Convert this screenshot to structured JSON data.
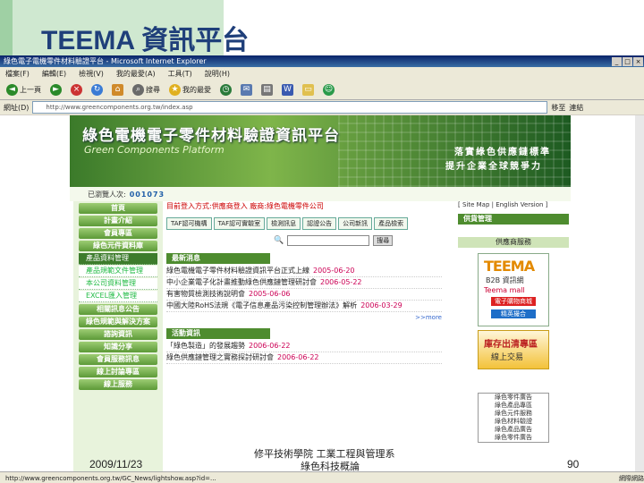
{
  "slide": {
    "title": "TEEMA 資訊平台",
    "footer_date": "2009/11/23",
    "footer_center_line1": "修平技術學院 工業工程與管理系",
    "footer_center_line2": "綠色科技概論",
    "footer_page": "90"
  },
  "browser": {
    "title": "綠色電子電機零件材料驗證平台 - Microsoft Internet Explorer",
    "menu": [
      "檔案(F)",
      "編輯(E)",
      "檢視(V)",
      "我的最愛(A)",
      "工具(T)",
      "說明(H)"
    ],
    "toolbar": {
      "back": "上一頁",
      "search": "搜尋",
      "favorites": "我的最愛"
    },
    "address_label": "網址(D)",
    "address_value": "http://www.greencomponents.org.tw/index.asp",
    "go_label": "移至",
    "links_label": "連結",
    "status_text": "http://www.greencomponents.org.tw/GC_News/lightshow.asp?id=...",
    "status_zone": "網際網路"
  },
  "site": {
    "banner_title": "綠色電機電子零件材料驗證資訊平台",
    "banner_subtitle": "Green Components Platform",
    "slogan1": "落實綠色供應鏈標準",
    "slogan2": "提升企業全球競爭力",
    "counter_label": "已瀏覽人次:",
    "counter_value": "001073",
    "notice": "目前登入方式:供應商登入  廠商:綠色電機零件公司",
    "lang_links": "[ Site Map | English Version ]",
    "nav": [
      "首頁",
      "計畫介紹",
      "會員專區",
      "綠色元件資料庫"
    ],
    "subnav": [
      "產品資料管理",
      "產品規範文件管理",
      "本公司資料管理",
      "EXCEL匯入管理"
    ],
    "nav2": [
      "相關訊息公告",
      "綠色規範與解決方案",
      "諮詢資訊",
      "知識分享",
      "會員服務訊息",
      "線上討論專區",
      "線上服務"
    ],
    "tabs": [
      "TAF認可機構",
      "TAF認可實驗室",
      "檢測訊息",
      "認證公告",
      "公司新訊",
      "產品檢索"
    ],
    "search_btn": "搜尋",
    "news_title": "最新消息",
    "news": [
      {
        "text": "綠色電機電子零件材料驗證資訊平台正式上線",
        "date": "2005-06-20"
      },
      {
        "text": "中小企業電子化計畫推動綠色供應鏈管理研討會",
        "date": "2006-05-22"
      },
      {
        "text": "有害物質檢測技術說明會",
        "date": "2005-06-06"
      },
      {
        "text": "中國大陸RoHS法規《電子信息產品污染控制管理辦法》解析",
        "date": "2006-03-29"
      }
    ],
    "more": ">>more",
    "activity_title": "活動資訊",
    "activities": [
      {
        "text": "「綠色製造」的發展趨勢",
        "date": "2006-06-22"
      },
      {
        "text": "綠色供應鏈管理之實務探討研討會",
        "date": "2006-06-22"
      }
    ],
    "right_title": "供貨管理",
    "right_label": "供應商服務",
    "teema_big": "TEEMA",
    "teema_b2b": "B2B 資訊網",
    "teema_mall": "Teema mall",
    "teema_shop": "電子購物商城",
    "teema_deal": "精英撮合",
    "stock_line1": "庫存出清專區",
    "stock_line2": "線上交易",
    "ads": [
      "綠色零件廣告",
      "綠色產品專區",
      "綠色元件服務",
      "綠色材料驗證",
      "綠色產品廣告",
      "綠色零件廣告"
    ]
  },
  "colors": {
    "accent_green": "#4e8c2f",
    "title_blue": "#1f3f7a"
  }
}
